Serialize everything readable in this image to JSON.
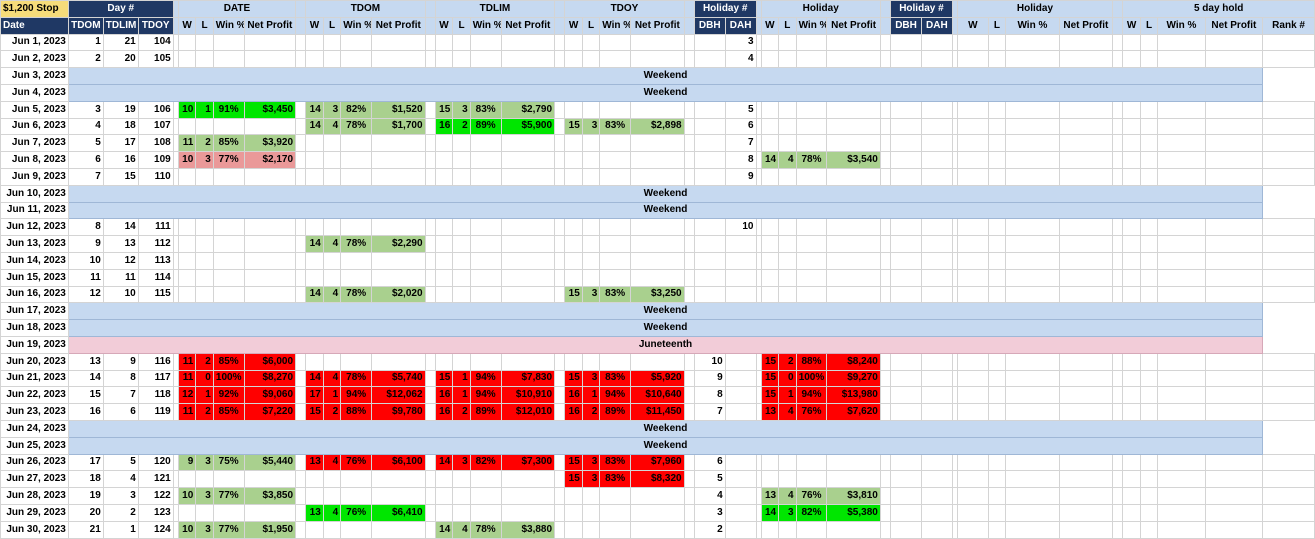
{
  "header": {
    "stop_label": "$1,200 Stop",
    "date_label": "Date",
    "day_num_label": "Day #",
    "tdom_label": "TDOM",
    "tdlim_label": "TDLIM",
    "tdoy_label": "TDOY",
    "sections": [
      "DATE",
      "TDOM",
      "TDLIM",
      "TDOY"
    ],
    "holiday_num_label": "Holiday #",
    "dbh_label": "DBH",
    "dah_label": "DAH",
    "holiday_label": "Holiday",
    "five_day_label": "5 day hold",
    "w_label": "W",
    "l_label": "L",
    "winpct_label": "Win %",
    "netprofit_label": "Net Profit",
    "rank_label": "Rank #"
  },
  "colors": {
    "bright": "#00e600",
    "lgreen": "#a9d08e",
    "red": "#ff0000",
    "pink": "#ea9999",
    "section_header": "#c6d9f0",
    "navy": "#1f3864",
    "juneteenth": "#f2ccd8"
  },
  "rows": [
    {
      "date": "Jun 1, 2023",
      "tdom": "1",
      "tdlim": "21",
      "tdoy": "104",
      "dah": "3"
    },
    {
      "date": "Jun 2, 2023",
      "tdom": "2",
      "tdlim": "20",
      "tdoy": "105",
      "dah": "4"
    },
    {
      "date": "Jun 3, 2023",
      "span": "Weekend"
    },
    {
      "date": "Jun 4, 2023",
      "span": "Weekend"
    },
    {
      "date": "Jun 5, 2023",
      "tdom": "3",
      "tdlim": "19",
      "tdoy": "106",
      "dah": "5",
      "g": {
        "date": {
          "w": "10",
          "l": "1",
          "pct": "91%",
          "np": "$3,450",
          "c": "bright"
        },
        "tdom": {
          "w": "14",
          "l": "3",
          "pct": "82%",
          "np": "$1,520",
          "c": "lgreen"
        },
        "tdlim": {
          "w": "15",
          "l": "3",
          "pct": "83%",
          "np": "$2,790",
          "c": "lgreen"
        }
      }
    },
    {
      "date": "Jun 6, 2023",
      "tdom": "4",
      "tdlim": "18",
      "tdoy": "107",
      "dah": "6",
      "g": {
        "tdom": {
          "w": "14",
          "l": "4",
          "pct": "78%",
          "np": "$1,700",
          "c": "lgreen"
        },
        "tdlim": {
          "w": "16",
          "l": "2",
          "pct": "89%",
          "np": "$5,900",
          "c": "bright"
        },
        "tdoy": {
          "w": "15",
          "l": "3",
          "pct": "83%",
          "np": "$2,898",
          "c": "lgreen"
        }
      }
    },
    {
      "date": "Jun 7, 2023",
      "tdom": "5",
      "tdlim": "17",
      "tdoy": "108",
      "dah": "7",
      "g": {
        "date": {
          "w": "11",
          "l": "2",
          "pct": "85%",
          "np": "$3,920",
          "c": "lgreen"
        }
      }
    },
    {
      "date": "Jun 8, 2023",
      "tdom": "6",
      "tdlim": "16",
      "tdoy": "109",
      "dah": "8",
      "g": {
        "date": {
          "w": "10",
          "l": "3",
          "pct": "77%",
          "np": "$2,170",
          "c": "pink"
        },
        "hol": {
          "w": "14",
          "l": "4",
          "pct": "78%",
          "np": "$3,540",
          "c": "lgreen"
        }
      }
    },
    {
      "date": "Jun 9, 2023",
      "tdom": "7",
      "tdlim": "15",
      "tdoy": "110",
      "dah": "9"
    },
    {
      "date": "Jun 10, 2023",
      "span": "Weekend"
    },
    {
      "date": "Jun 11, 2023",
      "span": "Weekend"
    },
    {
      "date": "Jun 12, 2023",
      "tdom": "8",
      "tdlim": "14",
      "tdoy": "111",
      "dah": "10"
    },
    {
      "date": "Jun 13, 2023",
      "tdom": "9",
      "tdlim": "13",
      "tdoy": "112",
      "g": {
        "tdom": {
          "w": "14",
          "l": "4",
          "pct": "78%",
          "np": "$2,290",
          "c": "lgreen"
        }
      }
    },
    {
      "date": "Jun 14, 2023",
      "tdom": "10",
      "tdlim": "12",
      "tdoy": "113"
    },
    {
      "date": "Jun 15, 2023",
      "tdom": "11",
      "tdlim": "11",
      "tdoy": "114"
    },
    {
      "date": "Jun 16, 2023",
      "tdom": "12",
      "tdlim": "10",
      "tdoy": "115",
      "g": {
        "tdom": {
          "w": "14",
          "l": "4",
          "pct": "78%",
          "np": "$2,020",
          "c": "lgreen"
        },
        "tdoy": {
          "w": "15",
          "l": "3",
          "pct": "83%",
          "np": "$3,250",
          "c": "lgreen"
        }
      }
    },
    {
      "date": "Jun 17, 2023",
      "span": "Weekend"
    },
    {
      "date": "Jun 18, 2023",
      "span": "Weekend"
    },
    {
      "date": "Jun 19, 2023",
      "span": "Juneteenth",
      "hol_row": true
    },
    {
      "date": "Jun 20, 2023",
      "tdom": "13",
      "tdlim": "9",
      "tdoy": "116",
      "dbh": "10",
      "g": {
        "date": {
          "w": "11",
          "l": "2",
          "pct": "85%",
          "np": "$6,000",
          "c": "red"
        },
        "hol": {
          "w": "15",
          "l": "2",
          "pct": "88%",
          "np": "$8,240",
          "c": "red"
        }
      }
    },
    {
      "date": "Jun 21, 2023",
      "tdom": "14",
      "tdlim": "8",
      "tdoy": "117",
      "dbh": "9",
      "g": {
        "date": {
          "w": "11",
          "l": "0",
          "pct": "100%",
          "np": "$8,270",
          "c": "red"
        },
        "tdom": {
          "w": "14",
          "l": "4",
          "pct": "78%",
          "np": "$5,740",
          "c": "red"
        },
        "tdlim": {
          "w": "15",
          "l": "1",
          "pct": "94%",
          "np": "$7,830",
          "c": "red"
        },
        "tdoy": {
          "w": "15",
          "l": "3",
          "pct": "83%",
          "np": "$5,920",
          "c": "red"
        },
        "hol": {
          "w": "15",
          "l": "0",
          "pct": "100%",
          "np": "$9,270",
          "c": "red"
        }
      }
    },
    {
      "date": "Jun 22, 2023",
      "tdom": "15",
      "tdlim": "7",
      "tdoy": "118",
      "dbh": "8",
      "g": {
        "date": {
          "w": "12",
          "l": "1",
          "pct": "92%",
          "np": "$9,060",
          "c": "red"
        },
        "tdom": {
          "w": "17",
          "l": "1",
          "pct": "94%",
          "np": "$12,062",
          "c": "red"
        },
        "tdlim": {
          "w": "16",
          "l": "1",
          "pct": "94%",
          "np": "$10,910",
          "c": "red"
        },
        "tdoy": {
          "w": "16",
          "l": "1",
          "pct": "94%",
          "np": "$10,640",
          "c": "red"
        },
        "hol": {
          "w": "15",
          "l": "1",
          "pct": "94%",
          "np": "$13,980",
          "c": "red"
        }
      }
    },
    {
      "date": "Jun 23, 2023",
      "tdom": "16",
      "tdlim": "6",
      "tdoy": "119",
      "dbh": "7",
      "g": {
        "date": {
          "w": "11",
          "l": "2",
          "pct": "85%",
          "np": "$7,220",
          "c": "red"
        },
        "tdom": {
          "w": "15",
          "l": "2",
          "pct": "88%",
          "np": "$9,780",
          "c": "red"
        },
        "tdlim": {
          "w": "16",
          "l": "2",
          "pct": "89%",
          "np": "$12,010",
          "c": "red"
        },
        "tdoy": {
          "w": "16",
          "l": "2",
          "pct": "89%",
          "np": "$11,450",
          "c": "red"
        },
        "hol": {
          "w": "13",
          "l": "4",
          "pct": "76%",
          "np": "$7,620",
          "c": "red"
        }
      }
    },
    {
      "date": "Jun 24, 2023",
      "span": "Weekend"
    },
    {
      "date": "Jun 25, 2023",
      "span": "Weekend"
    },
    {
      "date": "Jun 26, 2023",
      "tdom": "17",
      "tdlim": "5",
      "tdoy": "120",
      "dbh": "6",
      "g": {
        "date": {
          "w": "9",
          "l": "3",
          "pct": "75%",
          "np": "$5,440",
          "c": "lgreen"
        },
        "tdom": {
          "w": "13",
          "l": "4",
          "pct": "76%",
          "np": "$6,100",
          "c": "red"
        },
        "tdlim": {
          "w": "14",
          "l": "3",
          "pct": "82%",
          "np": "$7,300",
          "c": "red"
        },
        "tdoy": {
          "w": "15",
          "l": "3",
          "pct": "83%",
          "np": "$7,960",
          "c": "red"
        }
      }
    },
    {
      "date": "Jun 27, 2023",
      "tdom": "18",
      "tdlim": "4",
      "tdoy": "121",
      "dbh": "5",
      "g": {
        "tdoy": {
          "w": "15",
          "l": "3",
          "pct": "83%",
          "np": "$8,320",
          "c": "red"
        }
      }
    },
    {
      "date": "Jun 28, 2023",
      "tdom": "19",
      "tdlim": "3",
      "tdoy": "122",
      "dbh": "4",
      "g": {
        "date": {
          "w": "10",
          "l": "3",
          "pct": "77%",
          "np": "$3,850",
          "c": "lgreen"
        },
        "hol": {
          "w": "13",
          "l": "4",
          "pct": "76%",
          "np": "$3,810",
          "c": "lgreen"
        }
      }
    },
    {
      "date": "Jun 29, 2023",
      "tdom": "20",
      "tdlim": "2",
      "tdoy": "123",
      "dbh": "3",
      "g": {
        "tdom": {
          "w": "13",
          "l": "4",
          "pct": "76%",
          "np": "$6,410",
          "c": "bright"
        },
        "hol": {
          "w": "14",
          "l": "3",
          "pct": "82%",
          "np": "$5,380",
          "c": "bright"
        }
      }
    },
    {
      "date": "Jun 30, 2023",
      "tdom": "21",
      "tdlim": "1",
      "tdoy": "124",
      "dbh": "2",
      "g": {
        "date": {
          "w": "10",
          "l": "3",
          "pct": "77%",
          "np": "$1,950",
          "c": "lgreen"
        },
        "tdlim": {
          "w": "14",
          "l": "4",
          "pct": "78%",
          "np": "$3,880",
          "c": "lgreen"
        }
      }
    }
  ]
}
